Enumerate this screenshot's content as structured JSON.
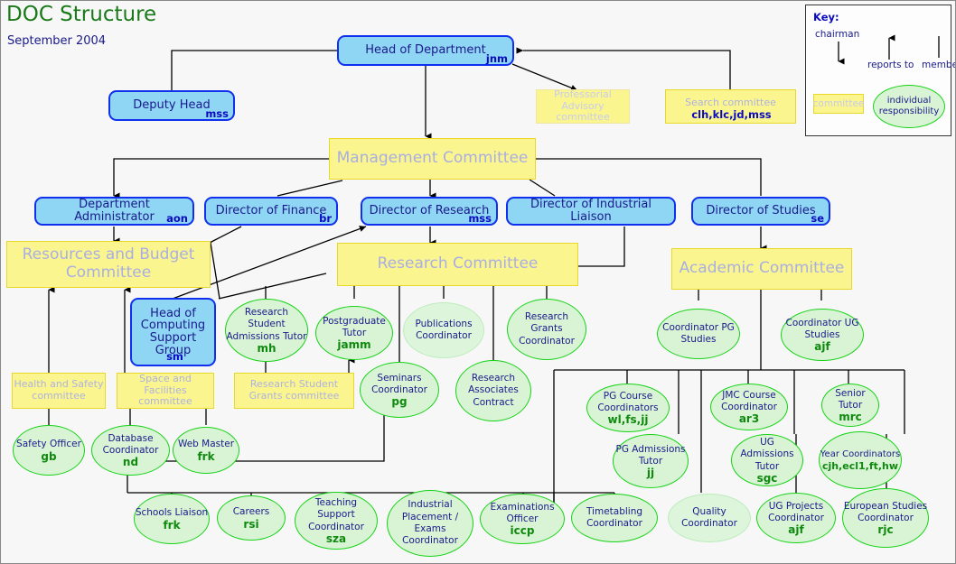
{
  "header": {
    "title": "DOC Structure",
    "date": "September 2004"
  },
  "key": {
    "title": "Key:",
    "chairman_label": "chairman",
    "reports_to_label": "reports to",
    "member_label": "member",
    "committee_label": "committee",
    "individual_label": "individual responsibility"
  },
  "colors": {
    "person_fill": "#8fd6f4",
    "person_border": "#1030ee",
    "committee_fill": "#fbf590",
    "committee_border": "#e8d82a",
    "role_fill": "#d9f3d5",
    "role_border": "#16d316",
    "title_green": "#1a7a1a",
    "text_blue": "#1a1a8c",
    "initials_green": "#0f8a0f",
    "committee_text": "#adb2e0"
  },
  "people": [
    {
      "id": "head_of_department",
      "title": "Head of Department",
      "initials": "jnm"
    },
    {
      "id": "deputy_head",
      "title": "Deputy Head",
      "initials": "mss"
    },
    {
      "id": "department_administrator",
      "title": "Department Administrator",
      "initials": "aon"
    },
    {
      "id": "director_of_finance",
      "title": "Director of Finance",
      "initials": "br"
    },
    {
      "id": "director_of_research",
      "title": "Director of Research",
      "initials": "mss"
    },
    {
      "id": "director_of_industrial_liaison",
      "title": "Director of Industrial Liaison",
      "initials": ""
    },
    {
      "id": "director_of_studies",
      "title": "Director of Studies",
      "initials": "se"
    },
    {
      "id": "head_of_computing_support_group",
      "title": "Head of Computing Support Group",
      "initials": "sm"
    }
  ],
  "committees": [
    {
      "id": "professorial_advisory_committee",
      "title": "Professorial Advisory committee",
      "initials": ""
    },
    {
      "id": "search_committee",
      "title": "Search committee",
      "initials": "clh,klc,jd,mss"
    },
    {
      "id": "management_committee",
      "title": "Management Committee",
      "initials": ""
    },
    {
      "id": "resources_and_budget_committee",
      "title": "Resources and Budget Committee",
      "initials": ""
    },
    {
      "id": "research_committee",
      "title": "Research  Committee",
      "initials": ""
    },
    {
      "id": "academic_committee",
      "title": "Academic Committee",
      "initials": ""
    },
    {
      "id": "health_and_safety_committee",
      "title": "Health and Safety committee",
      "initials": ""
    },
    {
      "id": "space_and_facilities_committee",
      "title": "Space and Facilities committee",
      "initials": ""
    },
    {
      "id": "research_student_grants_committee",
      "title": "Research Student Grants committee",
      "initials": ""
    }
  ],
  "roles": [
    {
      "id": "research_student_admissions_tutor",
      "title": "Research Student Admissions Tutor",
      "initials": "mh"
    },
    {
      "id": "postgraduate_tutor",
      "title": "Postgraduate Tutor",
      "initials": "jamm"
    },
    {
      "id": "publications_coordinator",
      "title": "Publications Coordinator",
      "initials": ""
    },
    {
      "id": "research_grants_coordinator",
      "title": "Research Grants Coordinator",
      "initials": ""
    },
    {
      "id": "seminars_coordinator",
      "title": "Seminars Coordinator",
      "initials": "pg"
    },
    {
      "id": "research_associates_contract",
      "title": "Research Associates Contract",
      "initials": ""
    },
    {
      "id": "coordinator_pg_studies",
      "title": "Coordinator PG Studies",
      "initials": ""
    },
    {
      "id": "coordinator_ug_studies",
      "title": "Coordinator UG Studies",
      "initials": "ajf"
    },
    {
      "id": "safety_officer",
      "title": "Safety Officer",
      "initials": "gb"
    },
    {
      "id": "database_coordinator",
      "title": "Database Coordinator",
      "initials": "nd"
    },
    {
      "id": "web_master",
      "title": "Web Master",
      "initials": "frk"
    },
    {
      "id": "pg_course_coordinators",
      "title": "PG Course Coordinators",
      "initials": "wl,fs,jj"
    },
    {
      "id": "pg_admissions_tutor",
      "title": "PG Admissions Tutor",
      "initials": "jj"
    },
    {
      "id": "jmc_course_coordinator",
      "title": "JMC Course Coordinator",
      "initials": "ar3"
    },
    {
      "id": "ug_admissions_tutor",
      "title": "UG Admissions Tutor",
      "initials": "sgc"
    },
    {
      "id": "senior_tutor",
      "title": "Senior Tutor",
      "initials": "mrc"
    },
    {
      "id": "year_coordinators",
      "title": "Year Coordinators",
      "initials": "cjh,ecl1,ft,hw"
    },
    {
      "id": "schools_liaison",
      "title": "Schools Liaison",
      "initials": "frk"
    },
    {
      "id": "careers",
      "title": "Careers",
      "initials": "rsi"
    },
    {
      "id": "teaching_support_coordinator",
      "title": "Teaching Support Coordinator",
      "initials": "sza"
    },
    {
      "id": "industrial_placement_exams_coordinator",
      "title": "Industrial Placement / Exams Coordinator",
      "initials": ""
    },
    {
      "id": "examinations_officer",
      "title": "Examinations Officer",
      "initials": "iccp"
    },
    {
      "id": "timetabling_coordinator",
      "title": "Timetabling Coordinator",
      "initials": ""
    },
    {
      "id": "quality_coordinator",
      "title": "Quality Coordinator",
      "initials": ""
    },
    {
      "id": "ug_projects_coordinator",
      "title": "UG Projects Coordinator",
      "initials": "ajf"
    },
    {
      "id": "european_studies_coordinator",
      "title": "European Studies Coordinator",
      "initials": "rjc"
    }
  ]
}
